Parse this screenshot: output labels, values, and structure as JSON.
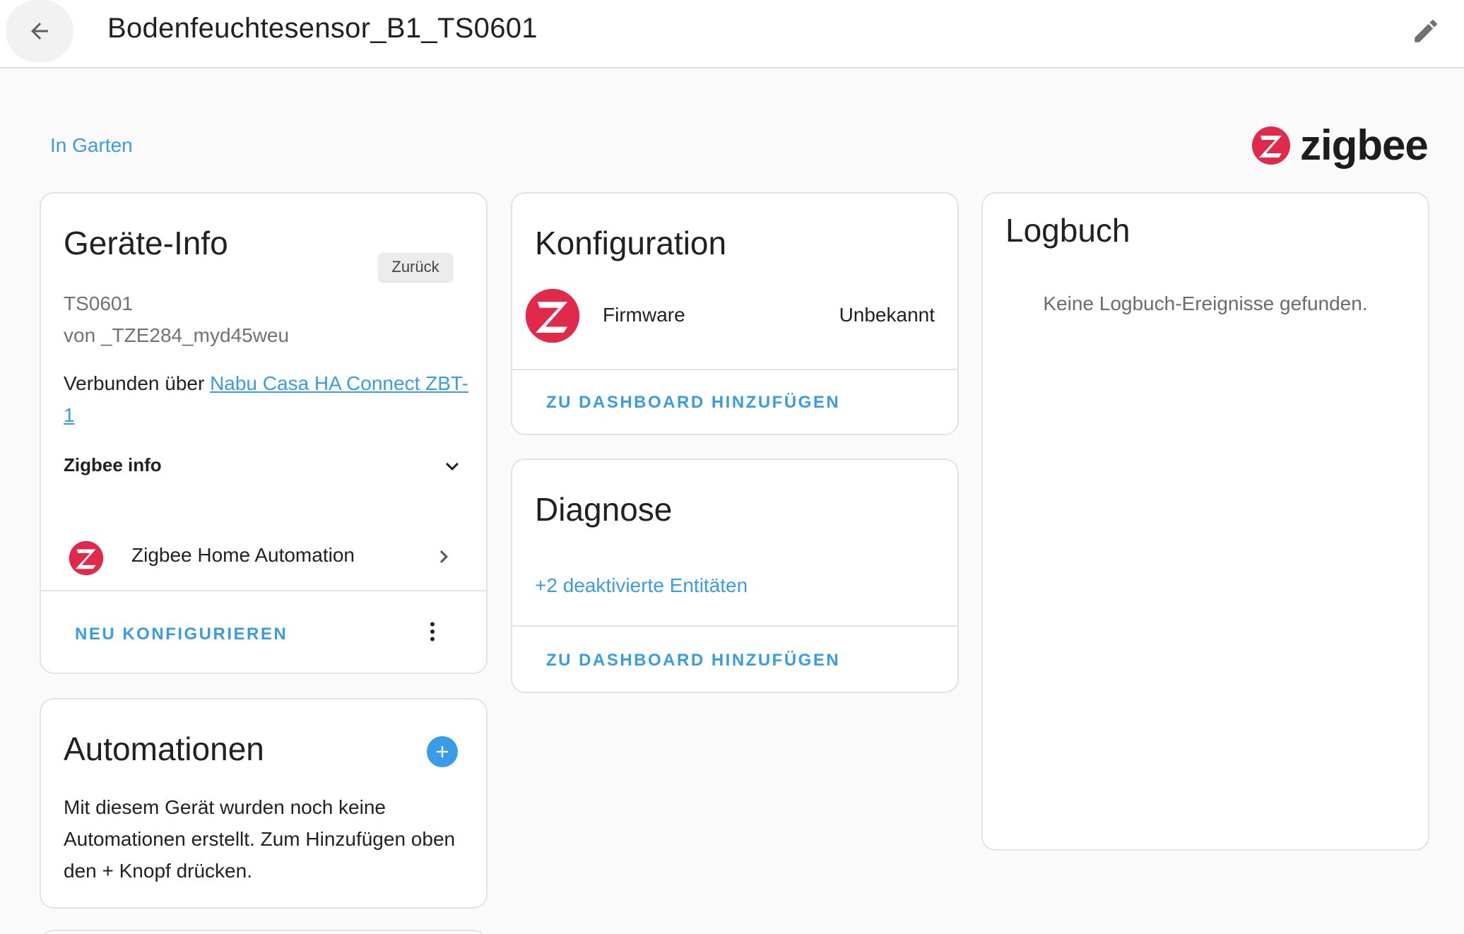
{
  "header": {
    "title": "Bodenfeuchtesensor_B1_TS0601",
    "back_icon": "arrow-left-icon",
    "edit_icon": "pencil-icon"
  },
  "area_link": "In Garten",
  "brand": {
    "name": "zigbee",
    "color": "#e12a4b"
  },
  "device_info": {
    "title": "Geräte-Info",
    "tooltip": "Zurück",
    "model": "TS0601",
    "manufacturer": "von _TZE284_myd45weu",
    "connected_prefix": "Verbunden über ",
    "connected_link_line1": "Nabu Casa HA Connect ZBT-",
    "connected_link_line2": "1",
    "zigbee_info_label": "Zigbee info",
    "integration_label": "Zigbee Home Automation",
    "reconfigure_button": "NEU KONFIGURIEREN"
  },
  "automations": {
    "title": "Automationen",
    "description": "Mit diesem Gerät wurden noch keine Automationen erstellt. Zum Hinzufügen oben den + Knopf drücken."
  },
  "configuration": {
    "title": "Konfiguration",
    "entity_name": "Firmware",
    "entity_state": "Unbekannt",
    "add_dashboard_button": "ZU DASHBOARD HINZUFÜGEN"
  },
  "diagnostics": {
    "title": "Diagnose",
    "disabled_entities_link": "+2 deaktivierte Entitäten",
    "add_dashboard_button": "ZU DASHBOARD HINZUFÜGEN"
  },
  "logbook": {
    "title": "Logbuch",
    "empty_text": "Keine Logbuch-Ereignisse gefunden."
  },
  "colors": {
    "accent": "#3a9be6",
    "zigbee_red": "#e12a4b"
  }
}
